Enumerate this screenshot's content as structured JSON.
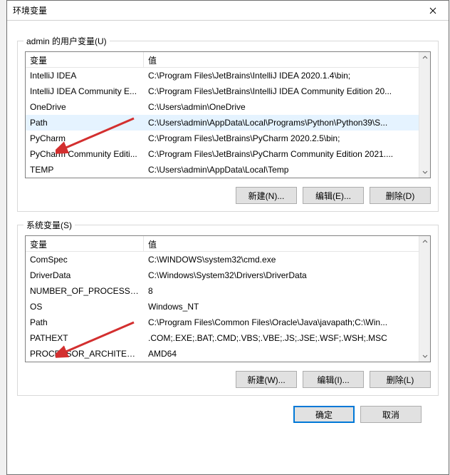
{
  "window": {
    "title": "环境变量"
  },
  "user_group": {
    "label": "admin 的用户变量(U)",
    "columns": {
      "var": "变量",
      "val": "值"
    },
    "rows": [
      {
        "var": "IntelliJ IDEA",
        "val": "C:\\Program Files\\JetBrains\\IntelliJ IDEA 2020.1.4\\bin;"
      },
      {
        "var": "IntelliJ IDEA Community E...",
        "val": "C:\\Program Files\\JetBrains\\IntelliJ IDEA Community Edition 20..."
      },
      {
        "var": "OneDrive",
        "val": "C:\\Users\\admin\\OneDrive"
      },
      {
        "var": "Path",
        "val": "C:\\Users\\admin\\AppData\\Local\\Programs\\Python\\Python39\\S..."
      },
      {
        "var": "PyCharm",
        "val": "C:\\Program Files\\JetBrains\\PyCharm 2020.2.5\\bin;"
      },
      {
        "var": "PyCharm Community Editi...",
        "val": "C:\\Program Files\\JetBrains\\PyCharm Community Edition 2021...."
      },
      {
        "var": "TEMP",
        "val": "C:\\Users\\admin\\AppData\\Local\\Temp"
      }
    ],
    "selected_index": 3,
    "buttons": {
      "new": "新建(N)...",
      "edit": "编辑(E)...",
      "delete": "删除(D)"
    }
  },
  "system_group": {
    "label": "系统变量(S)",
    "columns": {
      "var": "变量",
      "val": "值"
    },
    "rows": [
      {
        "var": "ComSpec",
        "val": "C:\\WINDOWS\\system32\\cmd.exe"
      },
      {
        "var": "DriverData",
        "val": "C:\\Windows\\System32\\Drivers\\DriverData"
      },
      {
        "var": "NUMBER_OF_PROCESSORS",
        "val": "8"
      },
      {
        "var": "OS",
        "val": "Windows_NT"
      },
      {
        "var": "Path",
        "val": "C:\\Program Files\\Common Files\\Oracle\\Java\\javapath;C:\\Win..."
      },
      {
        "var": "PATHEXT",
        "val": ".COM;.EXE;.BAT;.CMD;.VBS;.VBE;.JS;.JSE;.WSF;.WSH;.MSC"
      },
      {
        "var": "PROCESSOR_ARCHITECT...",
        "val": "AMD64"
      }
    ],
    "selected_index": -1,
    "buttons": {
      "new": "新建(W)...",
      "edit": "编辑(I)...",
      "delete": "删除(L)"
    }
  },
  "dialog_buttons": {
    "ok": "确定",
    "cancel": "取消"
  }
}
